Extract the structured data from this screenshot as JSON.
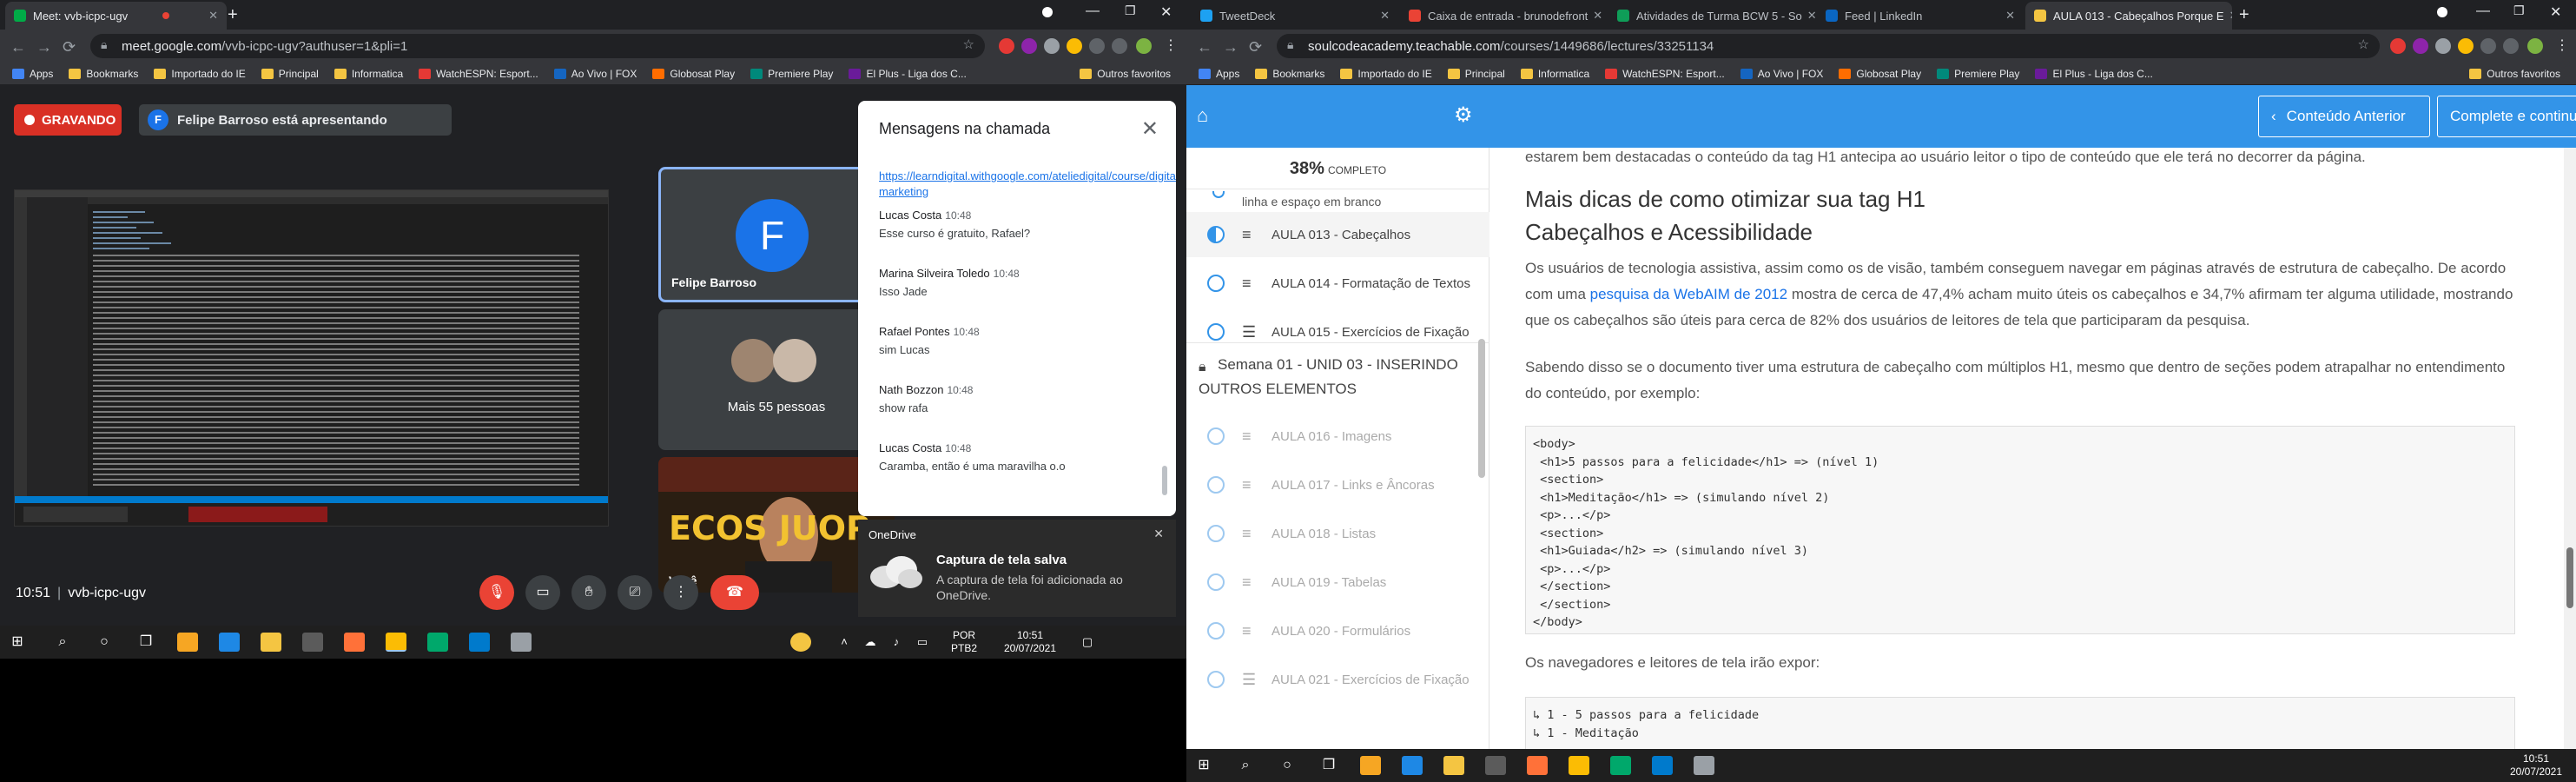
{
  "left": {
    "tabs": [
      {
        "title": "Meet: vvb-icpc-ugv",
        "active": true
      },
      {
        "title": "",
        "active": false
      }
    ],
    "url_domain": "meet.google.com",
    "url_path": "/vvb-icpc-ugv?authuser=1&pli=1",
    "bookmarks": [
      "Apps",
      "Bookmarks",
      "Importado do IE",
      "Principal",
      "Informatica",
      "WatchESPN: Esport...",
      "Ao Vivo | FOX",
      "Globosat Play",
      "Premiere Play",
      "El Plus - Liga dos C...",
      "Outros favoritos"
    ],
    "meet": {
      "recording_label": "GRAVANDO",
      "presenter_initial": "F",
      "presenter_text": "Felipe Barroso está apresentando",
      "tile1_initial": "F",
      "tile1_name": "Felipe Barroso",
      "tile2_name": "Mais 55 pessoas",
      "tile3_name": "Você",
      "time": "10:51",
      "meeting_code": "vvb-icpc-ugv",
      "chat_title": "Mensagens na chamada",
      "chat_link": "https://learndigital.withgoogle.com/ateliedigital/course/digital-marketing",
      "messages": [
        {
          "name": "Lucas Costa",
          "time": "10:48",
          "text": "Esse curso é gratuito, Rafael?"
        },
        {
          "name": "Marina Silveira Toledo",
          "time": "10:48",
          "text": "Isso Jade"
        },
        {
          "name": "Rafael Pontes",
          "time": "10:48",
          "text": "sim Lucas"
        },
        {
          "name": "Nath Bozzon",
          "time": "10:48",
          "text": "show rafa"
        },
        {
          "name": "Lucas Costa",
          "time": "10:48",
          "text": "Caramba, então é uma maravilha o.o"
        }
      ],
      "thumb_text": "ECOS JUOP"
    },
    "onedrive": {
      "header": "OneDrive",
      "title": "Captura de tela salva",
      "desc": "A captura de tela foi adicionada ao OneDrive."
    },
    "taskbar": {
      "lang1": "POR",
      "lang2": "PTB2",
      "time": "10:51",
      "date": "20/07/2021"
    }
  },
  "right": {
    "tabs": [
      {
        "title": "TweetDeck"
      },
      {
        "title": "Caixa de entrada - brunodefront"
      },
      {
        "title": "Atividades de Turma BCW 5 - So"
      },
      {
        "title": "Feed | LinkedIn"
      },
      {
        "title": "AULA 013 - Cabeçalhos Porque E"
      }
    ],
    "url_domain": "soulcodeacademy.teachable.com",
    "url_path": "/courses/1449686/lectures/33251134",
    "bookmarks": [
      "Apps",
      "Bookmarks",
      "Importado do IE",
      "Principal",
      "Informatica",
      "WatchESPN: Esport...",
      "Ao Vivo | FOX",
      "Globosat Play",
      "Premiere Play",
      "El Plus - Liga dos C...",
      "Outros favoritos"
    ],
    "header": {
      "prev": "Conteúdo Anterior",
      "next": "Complete e continue"
    },
    "progress": {
      "percent": "38%",
      "label": "COMPLETO"
    },
    "partial_lesson": "linha e espaço em branco",
    "lessons_a": [
      {
        "title": "AULA 013 - Cabeçalhos",
        "state": "current"
      },
      {
        "title": "AULA 014 - Formatação de Textos",
        "state": "todo"
      },
      {
        "title": "AULA 015 - Exercícios de Fixação",
        "state": "todo"
      }
    ],
    "section": "Semana 01 - UNID 03 - INSERINDO OUTROS ELEMENTOS",
    "lessons_b": [
      "AULA 016 - Imagens",
      "AULA 017 - Links e Âncoras",
      "AULA 018 - Listas",
      "AULA 019 - Tabelas",
      "AULA 020 - Formulários",
      "AULA 021 - Exercícios de Fixação"
    ],
    "content": {
      "p_top": "estarem bem destacadas o conteúdo da tag H1 antecipa ao usuário leitor o tipo de conteúdo que ele terá no decorrer da página.",
      "h1": "Mais dicas de como otimizar sua tag H1",
      "h2": "Cabeçalhos e Acessibilidade",
      "p1_a": "Os usuários de tecnologia assistiva, assim como os de visão, também conseguem navegar em páginas através de estrutura de cabeçalho. De acordo com uma ",
      "p1_link": "pesquisa da WebAIM de 2012",
      "p1_b": " mostra de cerca de 47,4% acham muito úteis os cabeçalhos e 34,7% afirmam ter alguma utilidade, mostrando que os cabeçalhos são úteis para cerca de 82% dos usuários de leitores de tela que participaram da pesquisa.",
      "p2": "Sabendo disso se o documento tiver uma estrutura de cabeçalho com múltiplos H1, mesmo que dentro de seções podem atrapalhar no entendimento do conteúdo, por exemplo:",
      "code1": "<body>\n <h1>5 passos para a felicidade</h1> => (nível 1)\n <section>\n <h1>Meditação</h1> => (simulando nível 2)\n <p>...</p>\n <section>\n <h1>Guiada</h2> => (simulando nível 3)\n <p>...</p>\n </section>\n </section>\n</body>",
      "p3": "Os navegadores e leitores de tela irão expor:",
      "code2": "↳ 1 - 5 passos para a felicidade\n↳ 1 - Meditação"
    },
    "taskbar": {
      "time": "10:51",
      "date": "20/07/2021"
    }
  },
  "colors": {
    "chrome_dark": "#202124",
    "chrome_mid": "#35363a",
    "teachable_blue": "#3394e8",
    "record_red": "#d93025",
    "link_blue": "#1a73e8"
  }
}
